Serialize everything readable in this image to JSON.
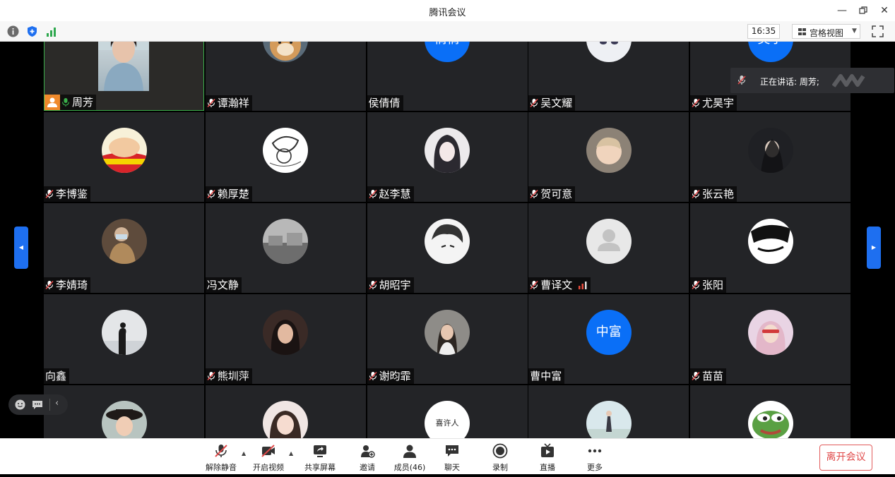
{
  "window": {
    "title": "腾讯会议"
  },
  "toolbar": {
    "time": "16:35",
    "view_label": "宫格视图"
  },
  "speaking": {
    "label": "正在讲话: 周芳;"
  },
  "participants": [
    {
      "name": "周芳",
      "avatar": "self-video"
    },
    {
      "name": "谭瀚祥",
      "avatar": "shiba-dog"
    },
    {
      "name": "侯倩倩",
      "avatar": "text",
      "avatar_text": "倩倩"
    },
    {
      "name": "吴文耀",
      "avatar": "anime-face"
    },
    {
      "name": "尤昊宇",
      "avatar": "text",
      "avatar_text": "昊宇"
    },
    {
      "name": "李博鉴",
      "avatar": "crayon-shin"
    },
    {
      "name": "赖厚楚",
      "avatar": "sketch-boy"
    },
    {
      "name": "赵李慧",
      "avatar": "anime-girl"
    },
    {
      "name": "贺可意",
      "avatar": "baby-photo"
    },
    {
      "name": "张云艳",
      "avatar": "dark-portrait"
    },
    {
      "name": "李婧琦",
      "avatar": "masked-person"
    },
    {
      "name": "冯文静",
      "avatar": "grey-scene"
    },
    {
      "name": "胡昭宇",
      "avatar": "bw-anime"
    },
    {
      "name": "曹译文",
      "avatar": "default-person"
    },
    {
      "name": "张阳",
      "avatar": "bw-manga"
    },
    {
      "name": "向鑫",
      "avatar": "silhouette"
    },
    {
      "name": "熊圳萍",
      "avatar": "woman-portrait"
    },
    {
      "name": "谢昀霏",
      "avatar": "woman-outdoor"
    },
    {
      "name": "曹中富",
      "avatar": "text",
      "avatar_text": "中富"
    },
    {
      "name": "苗苗",
      "avatar": "pink-girl"
    },
    {
      "name": "",
      "avatar": "hat-woman"
    },
    {
      "name": "",
      "avatar": "girl-portrait"
    },
    {
      "name": "",
      "avatar": "handwriting",
      "avatar_text": "喜许人"
    },
    {
      "name": "",
      "avatar": "dancer"
    },
    {
      "name": "",
      "avatar": "pepe-frog"
    }
  ],
  "bottombar": {
    "unmute": "解除静音",
    "start_video": "开启视频",
    "share_screen": "共享屏幕",
    "invite": "邀请",
    "members": "成员(46)",
    "chat": "聊天",
    "record": "录制",
    "live": "直播",
    "more": "更多",
    "leave": "离开会议"
  },
  "colors": {
    "accent": "#1e6ff0",
    "avatar_blue": "#0a6ff7",
    "leave_red": "#e04848",
    "speaking_green": "#3ab04a"
  }
}
